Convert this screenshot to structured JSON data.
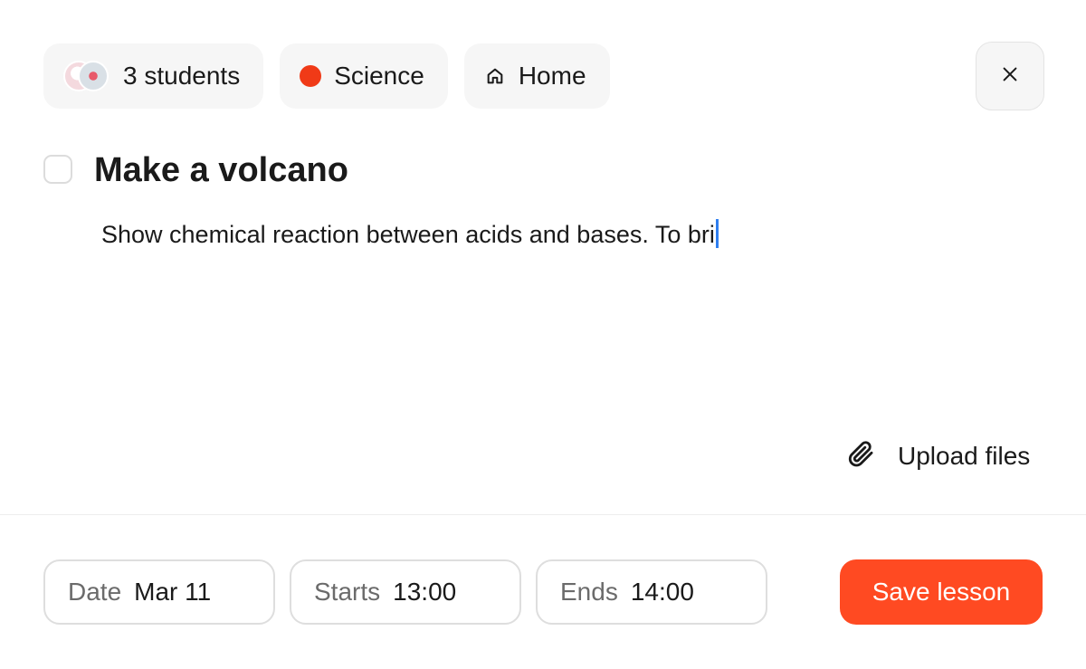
{
  "colors": {
    "accent": "#ff4a22",
    "science": "#f03a17",
    "caret": "#2f7ff0"
  },
  "chips": {
    "students_label": "3 students",
    "subject_label": "Science",
    "location_label": "Home",
    "location_icon": "home-icon"
  },
  "close_icon": "close-icon",
  "task": {
    "title": "Make a volcano",
    "description": "Show chemical reaction between acids and bases. To bri"
  },
  "upload": {
    "label": "Upload files",
    "icon": "paperclip-icon"
  },
  "footer": {
    "date_label": "Date",
    "date_value": "Mar 11",
    "start_label": "Starts",
    "start_value": "13:00",
    "end_label": "Ends",
    "end_value": "14:00",
    "save_label": "Save lesson"
  }
}
